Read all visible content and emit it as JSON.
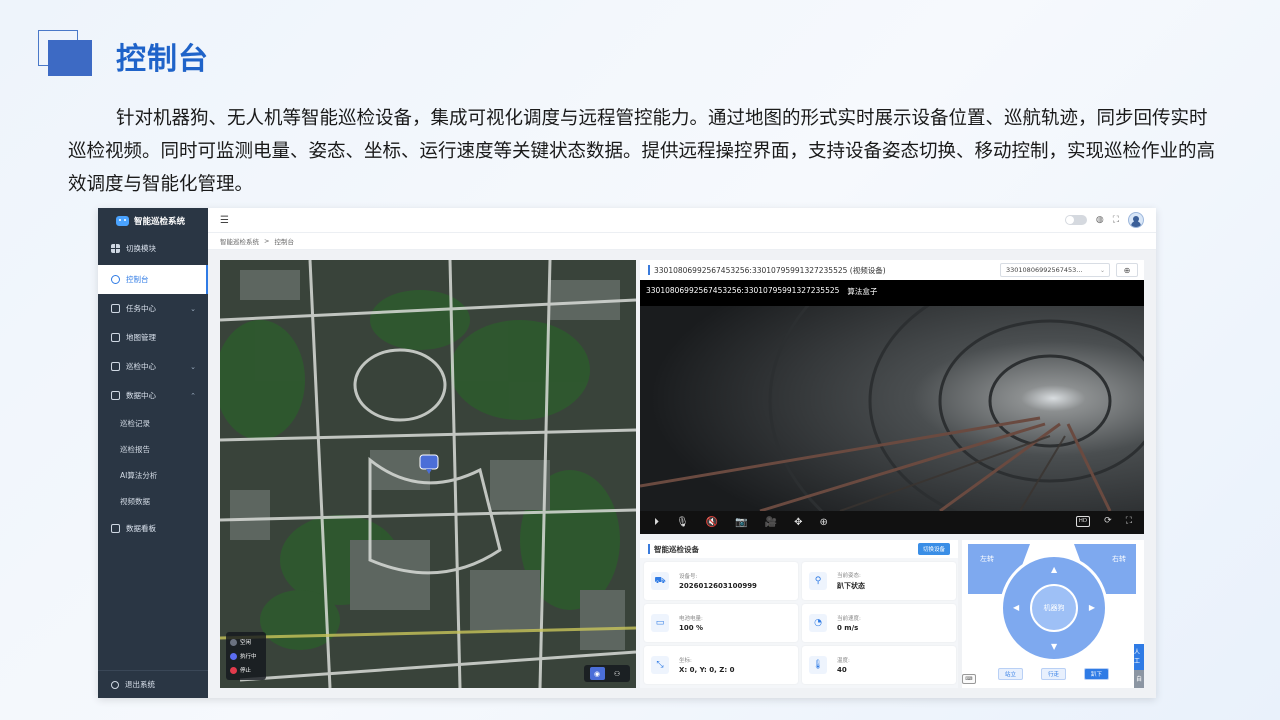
{
  "slide": {
    "title": "控制台",
    "description": "针对机器狗、无人机等智能巡检设备，集成可视化调度与远程管控能力。通过地图的形式实时展示设备位置、巡航轨迹，同步回传实时巡检视频。同时可监测电量、姿态、坐标、运行速度等关键状态数据。提供远程操控界面，支持设备姿态切换、移动控制，实现巡检作业的高效调度与智能化管理。"
  },
  "app": {
    "system_name": "智能巡检系统",
    "sidebar": {
      "items": [
        {
          "label": "切换模块",
          "icon": "grid-icon"
        },
        {
          "label": "控制台",
          "icon": "console-icon",
          "active": true
        },
        {
          "label": "任务中心",
          "icon": "task-icon",
          "chevron": "⌄"
        },
        {
          "label": "地图管理",
          "icon": "map-icon"
        },
        {
          "label": "巡检中心",
          "icon": "inspection-icon",
          "chevron": "⌄"
        },
        {
          "label": "数据中心",
          "icon": "data-icon",
          "chevron": "⌃"
        }
      ],
      "sub_items": [
        "巡检记录",
        "巡检报告",
        "AI算法分析",
        "视频数据"
      ],
      "dashboard": "数据看板",
      "logout": "退出系统"
    },
    "breadcrumb": [
      "智能巡检系统",
      "控制台"
    ],
    "map": {
      "legend": [
        {
          "label": "空闲",
          "color": "#6b7280"
        },
        {
          "label": "执行中",
          "color": "#5b6cf0"
        },
        {
          "label": "停止",
          "color": "#e23b4c"
        }
      ]
    },
    "video": {
      "header": "33010806992567453256:33010795991327235525 (视频设备)",
      "select_value": "33010806992567453...",
      "overlay_id": "33010806992567453256:33010795991327235525",
      "overlay_label": "算法盒子",
      "hd_label": "HD"
    },
    "device": {
      "title": "智能巡检设备",
      "switch_label": "切换设备",
      "cards": [
        {
          "label": "设备号:",
          "value": "2026012603100999",
          "icon": "device-icon"
        },
        {
          "label": "当前姿态:",
          "value": "趴下状态",
          "icon": "pose-icon"
        },
        {
          "label": "电池电量:",
          "value": "100 %",
          "icon": "battery-icon"
        },
        {
          "label": "当前速度:",
          "value": "0 m/s",
          "icon": "speed-icon"
        },
        {
          "label": "坐标:",
          "value": "X: 0, Y: 0, Z: 0",
          "icon": "coordinate-icon"
        },
        {
          "label": "温度:",
          "value": "40",
          "icon": "temperature-icon"
        }
      ]
    },
    "control": {
      "left_turn": "左转",
      "right_turn": "右转",
      "center": "机器狗",
      "buttons": [
        "站立",
        "行走",
        "趴下"
      ],
      "side_tab_top": "人工",
      "side_tab_bottom": "自"
    }
  },
  "colors": {
    "accent": "#2f7be5",
    "title": "#1f63c9",
    "sidebar": "#2a3644",
    "control": "#7ea9ef"
  }
}
